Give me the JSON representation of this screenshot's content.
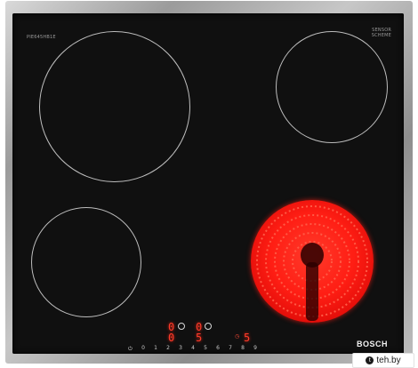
{
  "product": {
    "brand": "BOSCH",
    "model_text": "PIE645HB1E",
    "sensor_text_line1": "SENSOR",
    "sensor_text_line2": "SCHEME"
  },
  "controls": {
    "zone1_level": "0",
    "zone2_level": "0",
    "zone3_level": "0",
    "zone4_level": "5",
    "timer_value": "5",
    "slider_numbers": [
      "0",
      "1",
      "2",
      "3",
      "4",
      "5",
      "6",
      "7",
      "8",
      "9"
    ]
  },
  "watermark": {
    "site_name": "teh.by",
    "logo_letter": "t"
  },
  "colors": {
    "glass": "#101010",
    "heat": "#ff1e14",
    "display_red": "#ff3b2a",
    "frame": "#a8a8a8"
  },
  "icons": {
    "zone_ring": "zone-ring-icon",
    "power": "power-icon",
    "timer": "timer-icon"
  }
}
